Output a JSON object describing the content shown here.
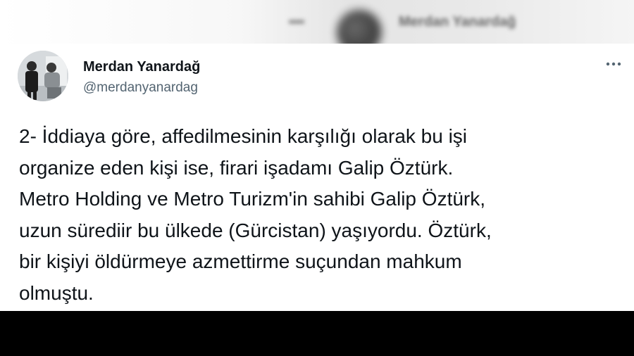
{
  "background": {
    "blurred_author": "Merdan Yanardağ"
  },
  "tweet": {
    "author": {
      "name": "Merdan Yanardağ",
      "handle": "@merdanyanardag",
      "avatar_icon": "profile-photo"
    },
    "more_icon": "more-horizontal-icon",
    "text_lines": [
      "2- İddiaya göre, affedilmesinin karşılığı olarak bu işi",
      "organize eden kişi ise, firari işadamı Galip Öztürk.",
      "Metro Holding ve Metro Turizm'in sahibi Galip Öztürk,",
      "uzun sürediir bu ülkede (Gürcistan) yaşıyordu. Öztürk,",
      "bir kişiyi öldürmeye azmettirme suçundan mahkum",
      "olmuştu."
    ]
  },
  "colors": {
    "text_primary": "#0f1419",
    "text_secondary": "#536471",
    "bottom_bar": "#000000"
  }
}
